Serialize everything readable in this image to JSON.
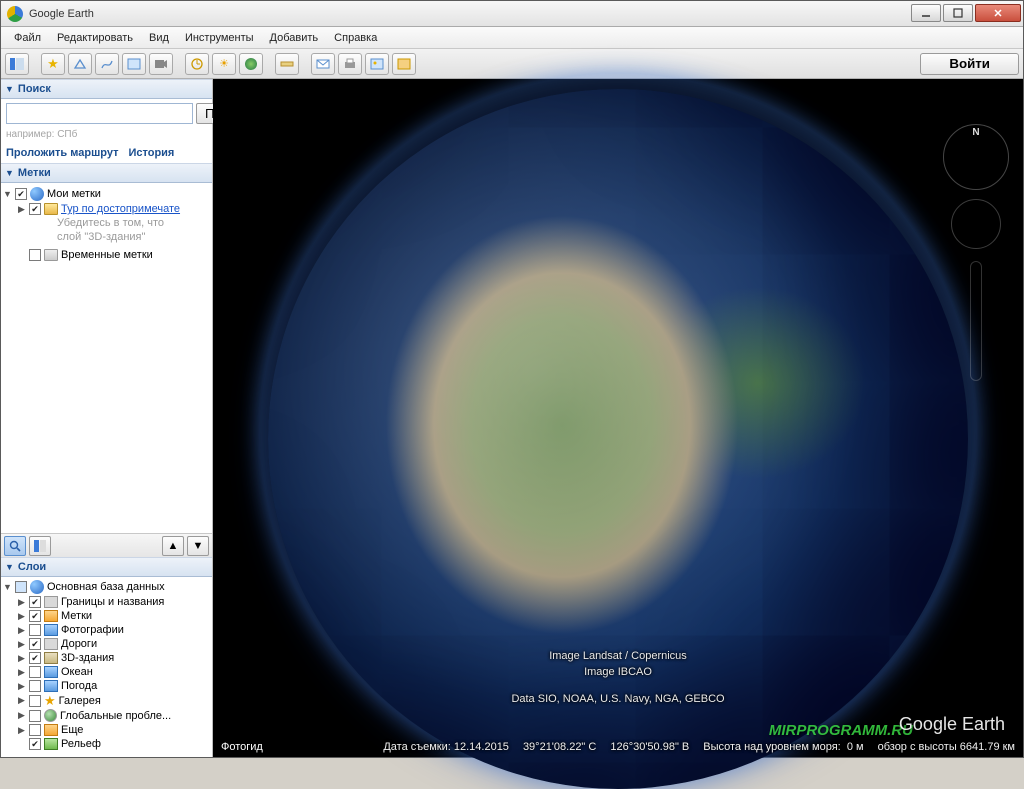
{
  "window": {
    "title": "Google Earth"
  },
  "menu": {
    "file": "Файл",
    "edit": "Редактировать",
    "view": "Вид",
    "tools": "Инструменты",
    "add": "Добавить",
    "help": "Справка"
  },
  "toolbar": {
    "login": "Войти",
    "icons": [
      "hide-sidebar",
      "placemark",
      "polygon",
      "path",
      "image-overlay",
      "record-tour",
      "history",
      "sunlight",
      "planet",
      "ruler",
      "email",
      "print",
      "save-image",
      "view-in-maps"
    ]
  },
  "sidebar": {
    "search": {
      "title": "Поиск",
      "button": "Поиск",
      "hint": "например: СПб",
      "route": "Проложить маршрут",
      "history": "История"
    },
    "places": {
      "title": "Метки",
      "my_places": "Мои метки",
      "tour_link": "Тур по достопримечате",
      "tour_hint1": "Убедитесь в том, что",
      "tour_hint2": "слой \"3D-здания\"",
      "temp_places": "Временные метки"
    },
    "layers": {
      "title": "Слои",
      "primary_db": "Основная база данных",
      "items": [
        {
          "label": "Границы и названия",
          "checked": true
        },
        {
          "label": "Метки",
          "checked": true
        },
        {
          "label": "Фотографии",
          "checked": false
        },
        {
          "label": "Дороги",
          "checked": true
        },
        {
          "label": "3D-здания",
          "checked": true
        },
        {
          "label": "Океан",
          "checked": false
        },
        {
          "label": "Погода",
          "checked": false
        },
        {
          "label": "Галерея",
          "checked": false
        },
        {
          "label": "Глобальные пробле...",
          "checked": false
        },
        {
          "label": "Еще",
          "checked": false
        },
        {
          "label": "Рельеф",
          "checked": true
        }
      ]
    }
  },
  "map": {
    "compass_n": "N",
    "attrib1": "Image Landsat / Copernicus",
    "attrib2": "Image IBCAO",
    "attrib3": "Data SIO, NOAA, U.S. Navy, NGA, GEBCO",
    "ge_logo": "Google Earth",
    "watermark": "MIRPROGRAMM.RU"
  },
  "status": {
    "photoguide": "Фотогид",
    "imagery_date_label": "Дата съемки:",
    "imagery_date": "12.14.2015",
    "lat": "39°21'08.22\" С",
    "lon": "126°30'50.98\" В",
    "elev_label": "Высота над уровнем моря:",
    "elev": "0 м",
    "eye_label": "обзор с высоты",
    "eye": "6641.79 км"
  }
}
